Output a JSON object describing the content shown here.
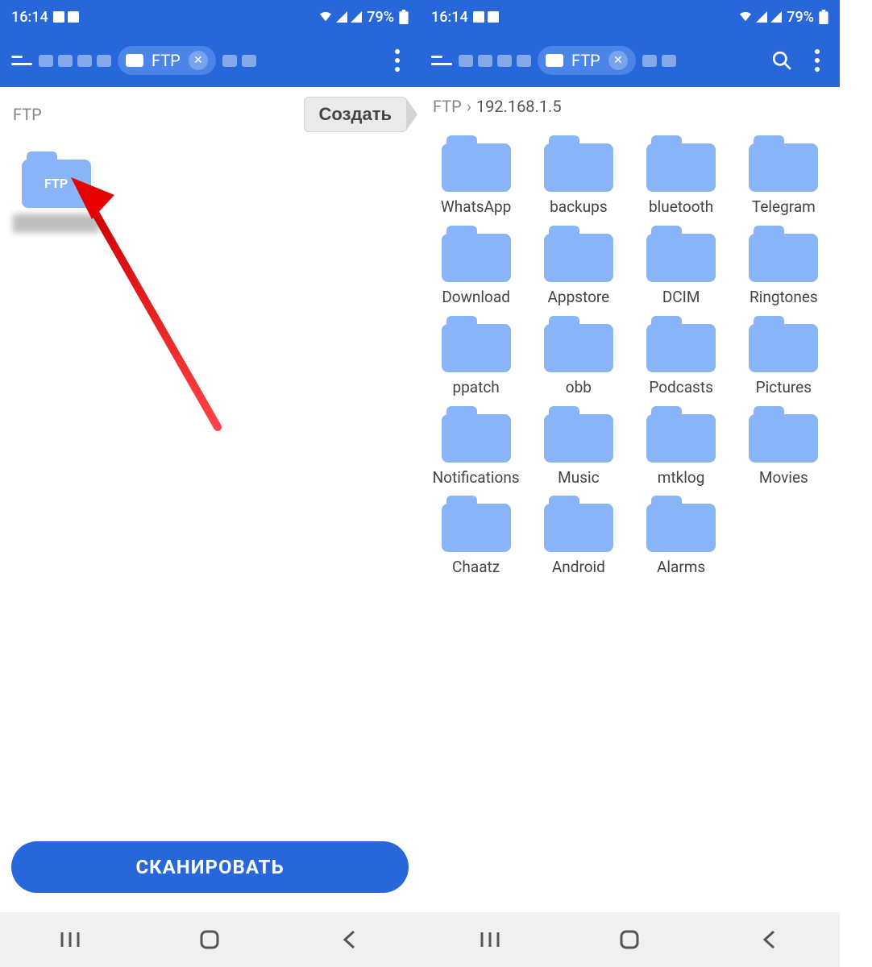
{
  "status": {
    "time": "16:14",
    "battery": "79%"
  },
  "toolbar": {
    "tab_label": "FTP"
  },
  "left": {
    "breadcrumb": "FTP",
    "create_label": "Создать",
    "main_folder_label": "FTP",
    "scan_label": "СКАНИРОВАТЬ"
  },
  "right": {
    "crumb_root": "FTP",
    "crumb_path": "192.168.1.5",
    "folders": [
      "WhatsApp",
      "backups",
      "bluetooth",
      "Telegram",
      "Download",
      "Appstore",
      "DCIM",
      "Ringtones",
      "ppatch",
      "obb",
      "Podcasts",
      "Pictures",
      "Notifications",
      "Music",
      "mtklog",
      "Movies",
      "Chaatz",
      "Android",
      "Alarms"
    ]
  }
}
